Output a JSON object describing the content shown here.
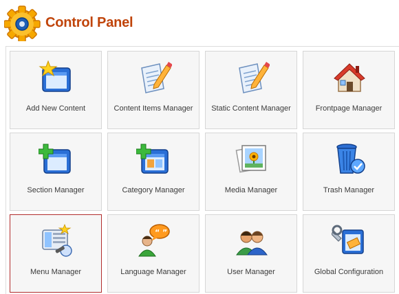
{
  "header": {
    "title": "Control Panel",
    "icon": "gear-icon",
    "accent_color": "#c0440a"
  },
  "tiles": [
    {
      "label": "Add New Content",
      "icon": "add-content-icon"
    },
    {
      "label": "Content Items Manager",
      "icon": "edit-document-icon"
    },
    {
      "label": "Static Content Manager",
      "icon": "edit-document-icon"
    },
    {
      "label": "Frontpage Manager",
      "icon": "home-icon"
    },
    {
      "label": "Section Manager",
      "icon": "add-window-icon"
    },
    {
      "label": "Category Manager",
      "icon": "add-window-icon"
    },
    {
      "label": "Media Manager",
      "icon": "media-icon"
    },
    {
      "label": "Trash Manager",
      "icon": "trash-icon"
    },
    {
      "label": "Menu Manager",
      "icon": "menu-manager-icon"
    },
    {
      "label": "Language Manager",
      "icon": "language-icon"
    },
    {
      "label": "User Manager",
      "icon": "users-icon"
    },
    {
      "label": "Global Configuration",
      "icon": "config-icon"
    }
  ],
  "selected_tile": "Menu Manager"
}
